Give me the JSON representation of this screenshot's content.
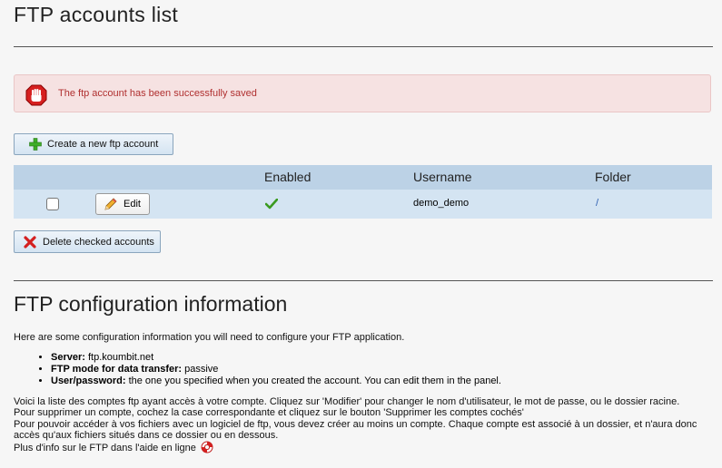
{
  "page_title": "FTP accounts list",
  "alert": {
    "message": "The ftp account has been successfully saved"
  },
  "create_button": {
    "label": "Create a new ftp account"
  },
  "table": {
    "columns": [
      "",
      "",
      "Enabled",
      "Username",
      "Folder"
    ],
    "rows": [
      {
        "edit_label": "Edit",
        "enabled": true,
        "username": "demo_demo",
        "folder": "/"
      }
    ]
  },
  "delete_button": {
    "label": "Delete checked accounts"
  },
  "config": {
    "title": "FTP configuration information",
    "intro": "Here are some configuration information you will need to configure your FTP application.",
    "items": [
      {
        "label": "Server:",
        "value": " ftp.koumbit.net"
      },
      {
        "label": "FTP mode for data transfer:",
        "value": " passive"
      },
      {
        "label": "User/password:",
        "value": " the one you specified when you created the account. You can edit them in the panel."
      }
    ],
    "paragraph_lines": [
      "Voici la liste des comptes ftp ayant accès à votre compte. Cliquez sur 'Modifier' pour changer le nom d'utilisateur, le mot de passe, ou le dossier racine.",
      "Pour supprimer un compte, cochez la case correspondante et cliquez sur le bouton 'Supprimer les comptes cochés'",
      "Pour pouvoir accéder à vos fichiers avec un logiciel de ftp, vous devez créer au moins un compte. Chaque compte est associé à un dossier, et n'aura donc",
      "accès qu'aux fichiers situés dans ce dossier ou en dessous."
    ],
    "help_text": "Plus d'info sur le FTP dans l'aide en ligne"
  },
  "colors": {
    "alert_text": "#b03030",
    "table_header": "#bcd2e6",
    "table_row": "#d4e4f2",
    "enabled_check": "#3a9a20"
  },
  "icons": {
    "alert": "stop-hand-icon",
    "create": "plus-icon",
    "edit": "pencil-icon",
    "enabled": "checkmark-icon",
    "delete": "red-x-icon",
    "help": "lifebuoy-icon"
  }
}
